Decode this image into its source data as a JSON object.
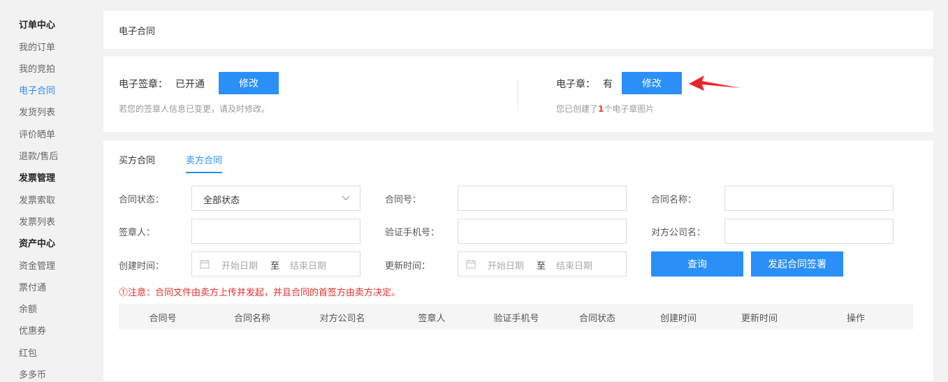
{
  "sidebar": {
    "items": [
      {
        "label": "订单中心",
        "type": "group"
      },
      {
        "label": "我的订单",
        "type": "link"
      },
      {
        "label": "我的竞拍",
        "type": "link"
      },
      {
        "label": "电子合同",
        "type": "active"
      },
      {
        "label": "发货列表",
        "type": "link"
      },
      {
        "label": "评价晒单",
        "type": "link"
      },
      {
        "label": "退款/售后",
        "type": "link"
      },
      {
        "label": "发票管理",
        "type": "group"
      },
      {
        "label": "发票索取",
        "type": "link"
      },
      {
        "label": "发票列表",
        "type": "link"
      },
      {
        "label": "资产中心",
        "type": "group"
      },
      {
        "label": "资金管理",
        "type": "link"
      },
      {
        "label": "票付通",
        "type": "link"
      },
      {
        "label": "余额",
        "type": "link"
      },
      {
        "label": "优惠券",
        "type": "link"
      },
      {
        "label": "红包",
        "type": "link"
      },
      {
        "label": "多多币",
        "type": "link"
      }
    ]
  },
  "breadcrumb": {
    "title": "电子合同"
  },
  "signature": {
    "label": "电子签章：",
    "status": "已开通",
    "modify_label": "修改",
    "hint": "若您的签章人信息已变更，请及时修改。"
  },
  "stamp": {
    "label": "电子章：",
    "status": "有",
    "modify_label": "修改",
    "hint_prefix": "您已创建了",
    "hint_count": "1",
    "hint_suffix": "个电子章图片"
  },
  "tabs": [
    {
      "label": "买方合同",
      "active": false
    },
    {
      "label": "卖方合同",
      "active": true
    }
  ],
  "filters": {
    "status_label": "合同状态：",
    "status_value": "全部状态",
    "contract_no_label": "合同号：",
    "contract_no_value": "",
    "contract_name_label": "合同名称：",
    "contract_name_value": "",
    "signer_label": "签章人：",
    "signer_value": "",
    "phone_label": "验证手机号：",
    "phone_value": "",
    "counterparty_label": "对方公司名：",
    "counterparty_value": "",
    "created_label": "创建时间：",
    "updated_label": "更新时间：",
    "start_placeholder": "开始日期",
    "to_label": "至",
    "end_placeholder": "结束日期"
  },
  "actions": {
    "query_label": "查询",
    "initiate_label": "发起合同签署"
  },
  "notice": "⓵注意：合同文件由卖方上传并发起，并且合同的首签方由卖方决定。",
  "table": {
    "columns": [
      "合同号",
      "合同名称",
      "对方公司名",
      "签章人",
      "验证手机号",
      "合同状态",
      "创建时间",
      "更新时间",
      "操作"
    ]
  },
  "colors": {
    "accent": "#2a8ff7",
    "warning": "#e0312b",
    "arrow": "#e8262c"
  }
}
